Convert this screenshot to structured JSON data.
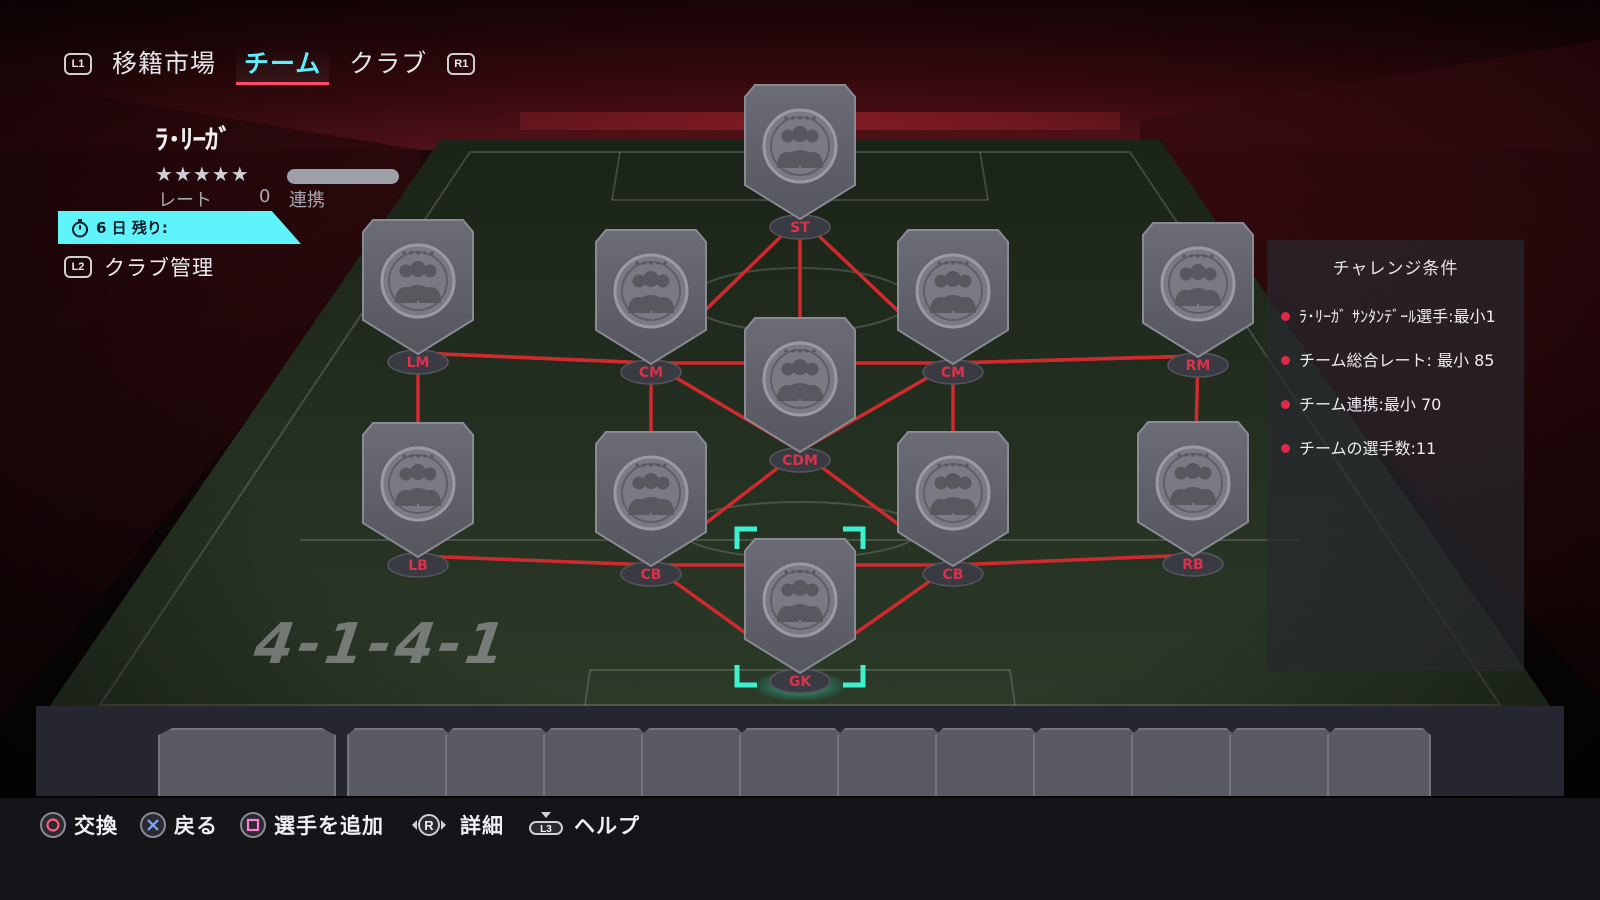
{
  "nav": {
    "left_shoulder": "L1",
    "right_shoulder": "R1",
    "tabs": [
      {
        "label": "移籍市場",
        "active": false
      },
      {
        "label": "チーム",
        "active": true
      },
      {
        "label": "クラブ",
        "active": false
      }
    ]
  },
  "squad": {
    "name": "ﾗ･ﾘｰｶﾞ",
    "stars": "★★★★★",
    "rating_label": "レート",
    "rating_value": "0",
    "chemistry_label": "連携",
    "chemistry_fill": 0
  },
  "timer": {
    "text": "6 日 残り:",
    "icon": "stopwatch-icon"
  },
  "club_management": {
    "button_hint": "L2",
    "label": "クラブ管理"
  },
  "formation": {
    "name": "4-1-4-1",
    "selected_position": "GK",
    "positions": [
      {
        "label": "ST"
      },
      {
        "label": "LM"
      },
      {
        "label": "CM"
      },
      {
        "label": "CM"
      },
      {
        "label": "RM"
      },
      {
        "label": "CDM"
      },
      {
        "label": "LB"
      },
      {
        "label": "CB"
      },
      {
        "label": "CB"
      },
      {
        "label": "RB"
      },
      {
        "label": "GK"
      }
    ]
  },
  "challenge": {
    "title": "チャレンジ条件",
    "requirements": [
      "ﾗ･ﾘｰｶﾞ ｻﾝﾀﾝﾃﾞｰﾙ選手:最小1",
      "チーム総合レート: 最小 85",
      "チーム連携:最小 70",
      "チームの選手数:11"
    ]
  },
  "controls": [
    {
      "button": "circle",
      "label": "交換"
    },
    {
      "button": "cross",
      "label": "戻る"
    },
    {
      "button": "square",
      "label": "選手を追加"
    },
    {
      "button": "R",
      "label": "詳細"
    },
    {
      "button": "L3",
      "label": "ヘルプ"
    }
  ],
  "colors": {
    "accent_cyan": "#5af0ff",
    "link_red": "#d12a2e",
    "card_gray": "#62626c",
    "requirement_dot": "#e0284a"
  }
}
